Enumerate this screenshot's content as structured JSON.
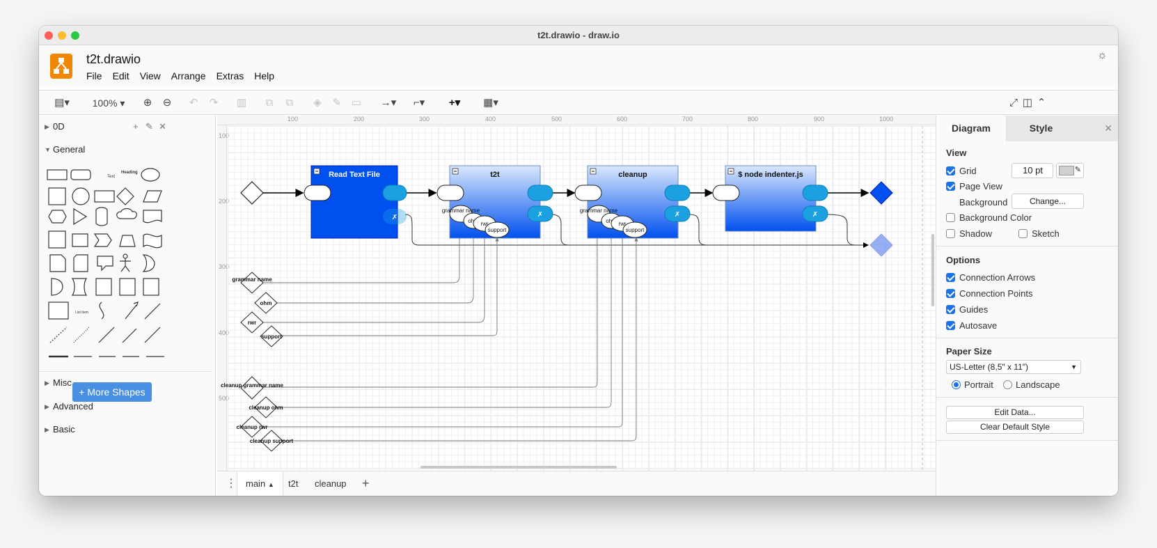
{
  "window": {
    "title": "t2t.drawio - draw.io"
  },
  "header": {
    "file_name": "t2t.drawio",
    "menu": [
      "File",
      "Edit",
      "View",
      "Arrange",
      "Extras",
      "Help"
    ]
  },
  "toolbar": {
    "zoom": "100%"
  },
  "sidebar": {
    "sections": {
      "od": "0D",
      "general": "General",
      "misc": "Misc",
      "advanced": "Advanced",
      "basic": "Basic"
    },
    "shape_text": "Text",
    "shape_heading": "Heading",
    "shape_list_item": "List Item",
    "more_shapes": "More Shapes"
  },
  "canvas": {
    "ruler_h": [
      "100",
      "200",
      "300",
      "400",
      "500",
      "600",
      "700",
      "800",
      "900",
      "1000"
    ],
    "ruler_v": [
      "100",
      "200",
      "300",
      "400",
      "500"
    ],
    "containers": [
      {
        "title": "Read Text File"
      },
      {
        "title": "t2t"
      },
      {
        "title": "cleanup"
      },
      {
        "title": "$ node indenter.js"
      }
    ],
    "ports": {
      "grammar_name": "grammar name",
      "grammar_short": "grammar name",
      "ohm": "ohm",
      "rwr": "rwr",
      "support": "support",
      "x_mark": "✗"
    },
    "diamonds": {
      "grammar": "grammar name",
      "ohm": "ohm",
      "rwr": "rwr",
      "support": "support",
      "cleanup_grammar": "cleanup grammar name",
      "cleanup_ohm": "cleanup ohm",
      "cleanup_rwr": "cleanup rwr",
      "cleanup_support": "cleanup support"
    }
  },
  "page_tabs": [
    "main",
    "t2t",
    "cleanup"
  ],
  "format_panel": {
    "tabs": [
      "Diagram",
      "Style"
    ],
    "view_title": "View",
    "grid": "Grid",
    "grid_size": "10 pt",
    "page_view": "Page View",
    "background": "Background",
    "change": "Change...",
    "background_color": "Background Color",
    "shadow": "Shadow",
    "sketch": "Sketch",
    "options_title": "Options",
    "connection_arrows": "Connection Arrows",
    "connection_points": "Connection Points",
    "guides": "Guides",
    "autosave": "Autosave",
    "paper_size_title": "Paper Size",
    "paper_size": "US-Letter (8,5\" x 11\")",
    "portrait": "Portrait",
    "landscape": "Landscape",
    "edit_data": "Edit Data...",
    "clear_default_style": "Clear Default Style"
  },
  "colors": {
    "accent": "#1a73e8",
    "container_blue": "#0050ef",
    "port_blue": "#1ba1e2",
    "logo_orange": "#f08705"
  }
}
